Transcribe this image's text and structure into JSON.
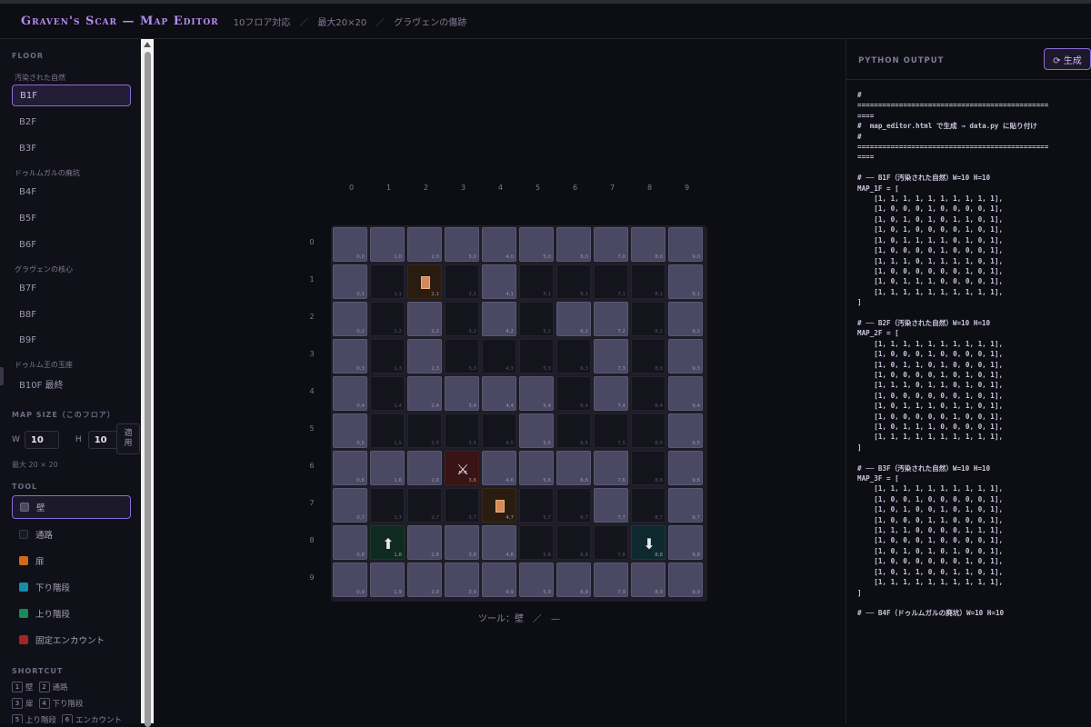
{
  "header": {
    "title": "Graven's Scar — Map Editor",
    "meta": [
      "10フロア対応",
      "最大20×20",
      "グラヴェンの傷跡"
    ],
    "sep": "／"
  },
  "sidebar": {
    "floor_label": "FLOOR",
    "groups": [
      {
        "label": "汚染された自然",
        "floors": [
          "B1F",
          "B2F",
          "B3F"
        ]
      },
      {
        "label": "ドゥルムガルの廃坑",
        "floors": [
          "B4F",
          "B5F",
          "B6F"
        ]
      },
      {
        "label": "グラヴェンの核心",
        "floors": [
          "B7F",
          "B8F",
          "B9F"
        ]
      },
      {
        "label": "ドゥルム王の玉座",
        "floors": [
          "B10F 最終"
        ]
      }
    ],
    "active_floor": "B1F",
    "map_size_label": "MAP SIZE（このフロア）",
    "w_label": "W",
    "w_value": "10",
    "h_label": "H",
    "h_value": "10",
    "apply_label": "適用",
    "max_note": "最大 20 × 20",
    "tool_label": "TOOL",
    "tools": [
      {
        "label": "壁",
        "color": "#4a4862"
      },
      {
        "label": "通路",
        "color": "#1a1a24"
      },
      {
        "label": "扉",
        "color": "#d06a1a"
      },
      {
        "label": "下り階段",
        "color": "#1a8aa8"
      },
      {
        "label": "上り階段",
        "color": "#1a8a5a"
      },
      {
        "label": "固定エンカウント",
        "color": "#a82424"
      }
    ],
    "active_tool": "壁",
    "shortcut_label": "SHORTCUT",
    "shortcuts": [
      [
        {
          "key": "1",
          "label": "壁"
        },
        {
          "key": "2",
          "label": "通路"
        }
      ],
      [
        {
          "key": "3",
          "label": "扉"
        },
        {
          "key": "4",
          "label": "下り階段"
        }
      ],
      [
        {
          "key": "5",
          "label": "上り階段"
        },
        {
          "key": "6",
          "label": "エンカウント"
        }
      ]
    ]
  },
  "map": {
    "col_numbers": [
      "0",
      "1",
      "2",
      "3",
      "4",
      "5",
      "6",
      "7",
      "8",
      "9"
    ],
    "row_numbers": [
      "0",
      "1",
      "2",
      "3",
      "4",
      "5",
      "6",
      "7",
      "8",
      "9"
    ],
    "rows": [
      "WWWWWWWWWW",
      "WPDPWPPPPW",
      "WPWPWPWWPW",
      "WPWPPPPWPW",
      "WPWWWWPWPW",
      "WPPPPWPPPW",
      "WWWEWWWWPW",
      "WPPPDPPWPW",
      "WUWWWPPPNW",
      "WWWWWWWWWW"
    ],
    "legend": {
      "W": "壁",
      "P": "通路",
      "D": "扉",
      "N": "下り階段",
      "U": "上り階段",
      "E": "固定エンカウント"
    },
    "glyphs": {
      "encounter": "⚔",
      "up": "⬆",
      "down": "⬇"
    },
    "status": "ツール：壁　／　—"
  },
  "output": {
    "title": "PYTHON OUTPUT",
    "generate_label": "⟳ 生成",
    "code": "#\n==============================================\n====\n#  map_editor.html で生成 → data.py に貼り付け\n#\n==============================================\n====\n\n# ── B1F（汚染された自然）W=10 H=10\nMAP_1F = [\n    [1, 1, 1, 1, 1, 1, 1, 1, 1, 1],\n    [1, 0, 0, 0, 1, 0, 0, 0, 0, 1],\n    [1, 0, 1, 0, 1, 0, 1, 1, 0, 1],\n    [1, 0, 1, 0, 0, 0, 0, 1, 0, 1],\n    [1, 0, 1, 1, 1, 1, 0, 1, 0, 1],\n    [1, 0, 0, 0, 0, 1, 0, 0, 0, 1],\n    [1, 1, 1, 0, 1, 1, 1, 1, 0, 1],\n    [1, 0, 0, 0, 0, 0, 0, 1, 0, 1],\n    [1, 0, 1, 1, 1, 0, 0, 0, 0, 1],\n    [1, 1, 1, 1, 1, 1, 1, 1, 1, 1],\n]\n\n# ── B2F（汚染された自然）W=10 H=10\nMAP_2F = [\n    [1, 1, 1, 1, 1, 1, 1, 1, 1, 1],\n    [1, 0, 0, 0, 1, 0, 0, 0, 0, 1],\n    [1, 0, 1, 1, 0, 1, 0, 0, 0, 1],\n    [1, 0, 0, 0, 0, 1, 0, 1, 0, 1],\n    [1, 1, 1, 0, 1, 1, 0, 1, 0, 1],\n    [1, 0, 0, 0, 0, 0, 0, 1, 0, 1],\n    [1, 0, 1, 1, 1, 0, 1, 1, 0, 1],\n    [1, 0, 0, 0, 0, 0, 1, 0, 0, 1],\n    [1, 0, 1, 1, 1, 0, 0, 0, 0, 1],\n    [1, 1, 1, 1, 1, 1, 1, 1, 1, 1],\n]\n\n# ── B3F（汚染された自然）W=10 H=10\nMAP_3F = [\n    [1, 1, 1, 1, 1, 1, 1, 1, 1, 1],\n    [1, 0, 0, 1, 0, 0, 0, 0, 0, 1],\n    [1, 0, 1, 0, 0, 1, 0, 1, 0, 1],\n    [1, 0, 0, 0, 1, 1, 0, 0, 0, 1],\n    [1, 1, 1, 0, 0, 0, 0, 1, 1, 1],\n    [1, 0, 0, 0, 1, 0, 0, 0, 0, 1],\n    [1, 0, 1, 0, 1, 0, 1, 0, 0, 1],\n    [1, 0, 0, 0, 0, 0, 0, 1, 0, 1],\n    [1, 0, 1, 1, 0, 0, 1, 1, 0, 1],\n    [1, 1, 1, 1, 1, 1, 1, 1, 1, 1],\n]\n\n# ── B4F（ドゥルムガルの廃坑）W=10 H=10"
  }
}
